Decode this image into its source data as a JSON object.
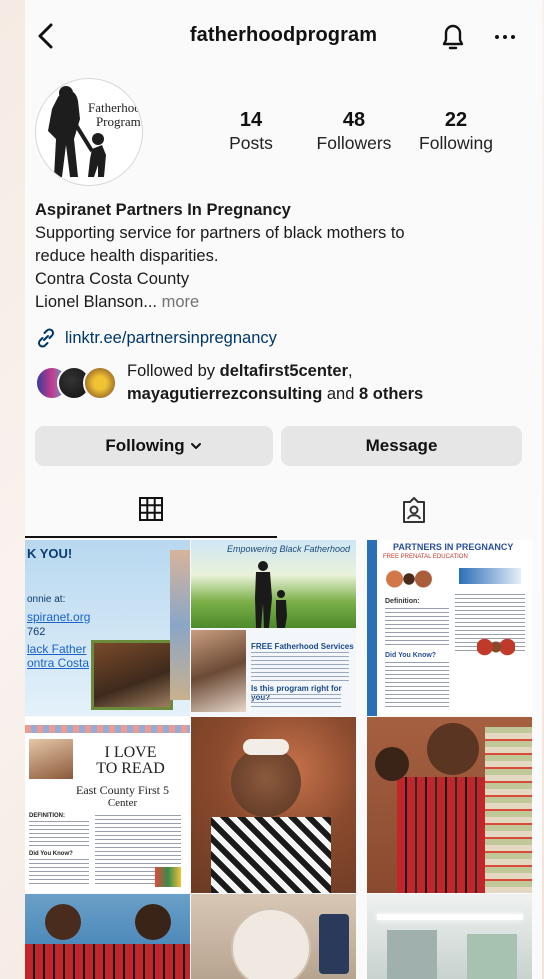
{
  "header": {
    "handle": "fatherhoodprogram"
  },
  "profile": {
    "avatar_text": [
      "Fatherhoo",
      "Program"
    ],
    "stats": [
      {
        "value": "14",
        "label": "Posts"
      },
      {
        "value": "48",
        "label": "Followers"
      },
      {
        "value": "22",
        "label": "Following"
      }
    ],
    "name": "Aspiranet Partners In Pregnancy",
    "bio_lines": [
      "Supporting service for partners of black mothers to",
      "reduce health disparities.",
      "Contra Costa County",
      "Lionel Blanson..."
    ],
    "bio_more": " more",
    "link": "linktr.ee/partnersinpregnancy",
    "followed_by": {
      "prefix": "Followed by ",
      "user1": "deltafirst5center",
      "comma": ",",
      "user2": "mayagutierrezconsulting",
      "and": " and ",
      "others": "8 others"
    }
  },
  "buttons": {
    "following": "Following",
    "message": "Message"
  },
  "icons": [
    "back-chevron-icon",
    "bell-icon",
    "more-icon",
    "link-icon",
    "chevron-down-icon",
    "grid-icon",
    "tagged-icon"
  ],
  "posts": [
    {
      "lines": [
        "K YOU!",
        "onnie at:",
        "spiranet.org",
        "762",
        "lack Father",
        "ontra Costa"
      ]
    },
    {
      "title": "Empowering Black Fatherhood",
      "lines": [
        "FREE Fatherhood Services",
        "Is this program right for you?"
      ]
    },
    {
      "title": "PARTNERS IN PREGNANCY",
      "subtitle": "FREE PRENATAL EDUCATION",
      "lines": [
        "Definition:",
        "Did You Know?"
      ]
    },
    {
      "lines": [
        "I LOVE",
        "TO READ",
        "East County First 5",
        "Center",
        "DEFINITION:",
        "Did You Know?"
      ]
    },
    {
      "caption": ""
    },
    {
      "caption": ""
    },
    {
      "caption": ""
    },
    {
      "caption": ""
    },
    {
      "caption": ""
    }
  ],
  "colors": {
    "link": "#00376b",
    "muted": "#737373",
    "button": "#e6e6e6",
    "accent": "#2b7bd1"
  }
}
